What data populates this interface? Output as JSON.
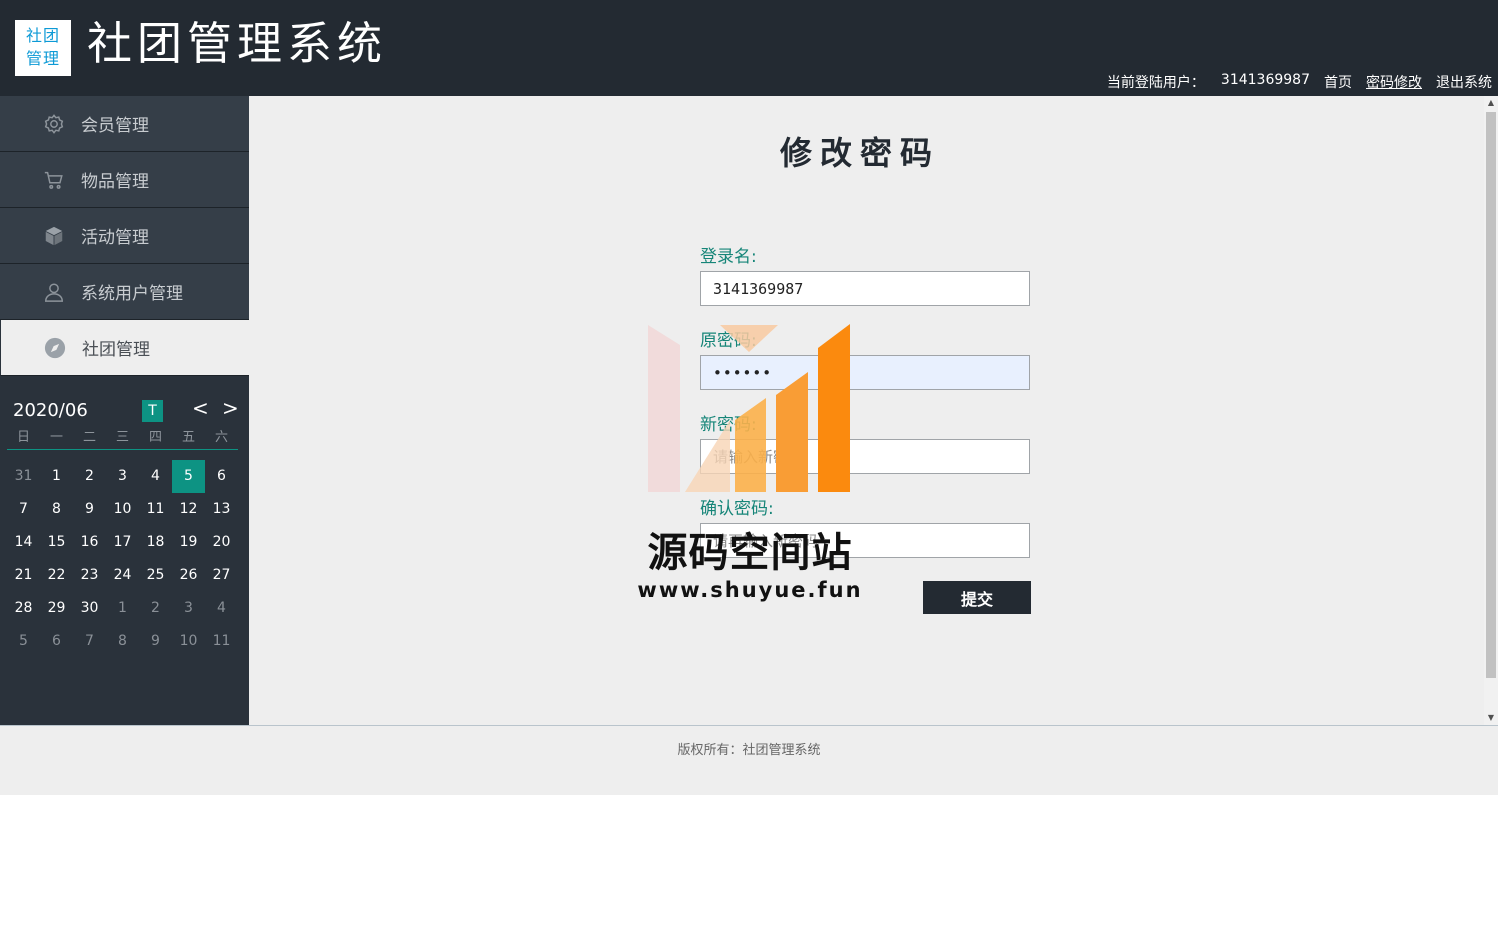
{
  "header": {
    "logo_line1": "社团",
    "logo_line2": "管理",
    "title": "社团管理系统",
    "user_label": "当前登陆用户：",
    "username": "3141369987",
    "nav": {
      "home": "首页",
      "change_password": "密码修改",
      "logout": "退出系统"
    }
  },
  "sidebar": {
    "items": [
      {
        "label": "会员管理",
        "icon": "gear-icon"
      },
      {
        "label": "物品管理",
        "icon": "cart-icon"
      },
      {
        "label": "活动管理",
        "icon": "cube-icon"
      },
      {
        "label": "系统用户管理",
        "icon": "user-icon"
      },
      {
        "label": "社团管理",
        "icon": "compass-icon",
        "active": true
      }
    ]
  },
  "calendar": {
    "month": "2020/06",
    "today_button": "T",
    "prev": "<",
    "next": ">",
    "weekdays": [
      "日",
      "一",
      "二",
      "三",
      "四",
      "五",
      "六"
    ],
    "days": [
      "31",
      "1",
      "2",
      "3",
      "4",
      "5",
      "6",
      "7",
      "8",
      "9",
      "10",
      "11",
      "12",
      "13",
      "14",
      "15",
      "16",
      "17",
      "18",
      "19",
      "20",
      "21",
      "22",
      "23",
      "24",
      "25",
      "26",
      "27",
      "28",
      "29",
      "30",
      "1",
      "2",
      "3",
      "4",
      "5",
      "6",
      "7",
      "8",
      "9",
      "10",
      "11"
    ],
    "selected_day": "5"
  },
  "form": {
    "title": "修改密码",
    "login_label": "登录名:",
    "login_value": "3141369987",
    "old_password_label": "原密码:",
    "old_password_value": "••••••",
    "new_password_label": "新密码:",
    "new_password_placeholder": "请输入新密码",
    "confirm_label": "确认密码:",
    "confirm_placeholder": "请再输入新密码",
    "submit": "提交"
  },
  "footer": {
    "text": "版权所有：社团管理系统"
  },
  "watermark": {
    "text": "源码空间站",
    "url": "www.shuyue.fun"
  },
  "colors": {
    "header_bg": "#232a32",
    "sidebar_bg": "#2a323b",
    "accent": "#0d9383",
    "label": "#168578"
  }
}
